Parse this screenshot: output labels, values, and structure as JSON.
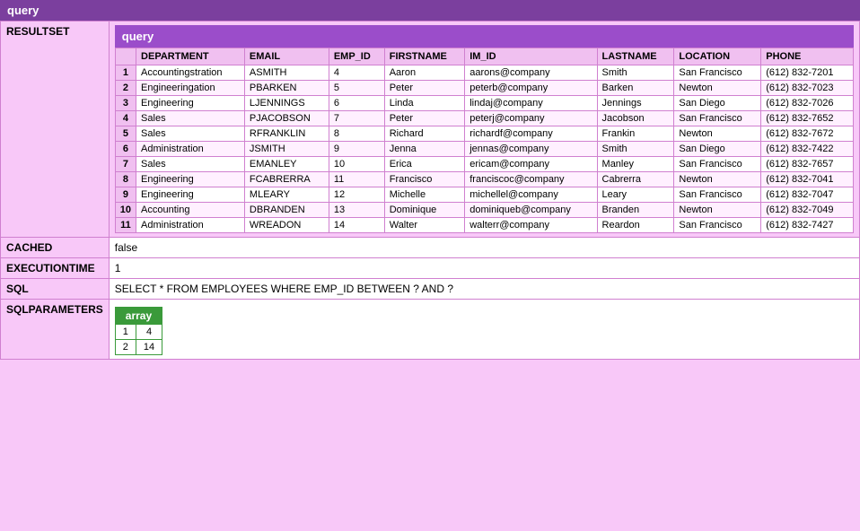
{
  "window": {
    "title": "query"
  },
  "resultset": {
    "query_label": "query",
    "columns": [
      "",
      "DEPARTMENT",
      "EMAIL",
      "EMP_ID",
      "FIRSTNAME",
      "IM_ID",
      "LASTNAME",
      "LOCATION",
      "PHONE"
    ],
    "rows": [
      {
        "num": "1",
        "department": "Accountingstration",
        "email": "ASMITH",
        "emp_id": "4",
        "firstname": "Aaron",
        "im_id": "aarons@company",
        "lastname": "Smith",
        "location": "San Francisco",
        "phone": "(612) 832-7201"
      },
      {
        "num": "2",
        "department": "Engineeringation",
        "email": "PBARKEN",
        "emp_id": "5",
        "firstname": "Peter",
        "im_id": "peterb@company",
        "lastname": "Barken",
        "location": "Newton",
        "phone": "(612) 832-7023"
      },
      {
        "num": "3",
        "department": "Engineering",
        "email": "LJENNINGS",
        "emp_id": "6",
        "firstname": "Linda",
        "im_id": "lindaj@company",
        "lastname": "Jennings",
        "location": "San Diego",
        "phone": "(612) 832-7026"
      },
      {
        "num": "4",
        "department": "Sales",
        "email": "PJACOBSON",
        "emp_id": "7",
        "firstname": "Peter",
        "im_id": "peterj@company",
        "lastname": "Jacobson",
        "location": "San Francisco",
        "phone": "(612) 832-7652"
      },
      {
        "num": "5",
        "department": "Sales",
        "email": "RFRANKLIN",
        "emp_id": "8",
        "firstname": "Richard",
        "im_id": "richardf@company",
        "lastname": "Frankin",
        "location": "Newton",
        "phone": "(612) 832-7672"
      },
      {
        "num": "6",
        "department": "Administration",
        "email": "JSMITH",
        "emp_id": "9",
        "firstname": "Jenna",
        "im_id": "jennas@company",
        "lastname": "Smith",
        "location": "San Diego",
        "phone": "(612) 832-7422"
      },
      {
        "num": "7",
        "department": "Sales",
        "email": "EMANLEY",
        "emp_id": "10",
        "firstname": "Erica",
        "im_id": "ericam@company",
        "lastname": "Manley",
        "location": "San Francisco",
        "phone": "(612) 832-7657"
      },
      {
        "num": "8",
        "department": "Engineering",
        "email": "FCABRERRA",
        "emp_id": "11",
        "firstname": "Francisco",
        "im_id": "franciscoc@company",
        "lastname": "Cabrerra",
        "location": "Newton",
        "phone": "(612) 832-7041"
      },
      {
        "num": "9",
        "department": "Engineering",
        "email": "MLEARY",
        "emp_id": "12",
        "firstname": "Michelle",
        "im_id": "michellel@company",
        "lastname": "Leary",
        "location": "San Francisco",
        "phone": "(612) 832-7047"
      },
      {
        "num": "10",
        "department": "Accounting",
        "email": "DBRANDEN",
        "emp_id": "13",
        "firstname": "Dominique",
        "im_id": "dominiqueb@company",
        "lastname": "Branden",
        "location": "Newton",
        "phone": "(612) 832-7049"
      },
      {
        "num": "11",
        "department": "Administration",
        "email": "WREADON",
        "emp_id": "14",
        "firstname": "Walter",
        "im_id": "walterr@company",
        "lastname": "Reardon",
        "location": "San Francisco",
        "phone": "(612) 832-7427"
      }
    ]
  },
  "labels": {
    "resultset": "RESULTSET",
    "cached": "CACHED",
    "executiontime": "EXECUTIONTIME",
    "sql": "SQL",
    "sqlparameters": "SQLPARAMETERS"
  },
  "cached": {
    "value": "false"
  },
  "executiontime": {
    "value": "1"
  },
  "sql": {
    "value": "SELECT * FROM EMPLOYEES WHERE EMP_ID BETWEEN ? AND ?"
  },
  "sqlparameters": {
    "array_label": "array",
    "rows": [
      {
        "col1": "1",
        "col2": "4"
      },
      {
        "col1": "2",
        "col2": "14"
      }
    ]
  }
}
